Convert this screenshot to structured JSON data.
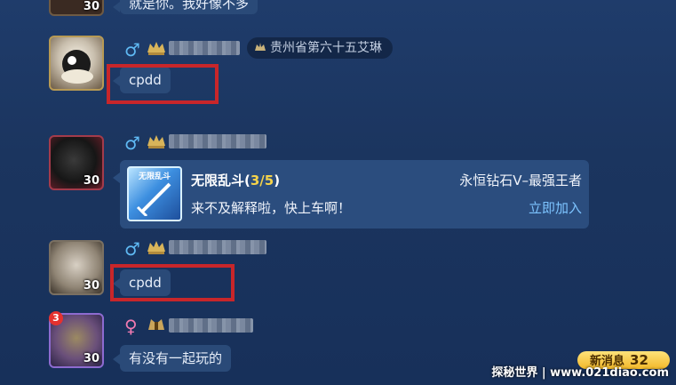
{
  "top_partial": {
    "level": "30",
    "text": "就是你。我好像不多"
  },
  "messages": [
    {
      "gender": "♂",
      "level": "",
      "title_tag": "贵州省第六十五艾琳",
      "text": "cpdd"
    },
    {
      "gender": "♂",
      "level": "30"
    },
    {
      "gender": "♂",
      "level": "30",
      "text": "cpdd"
    },
    {
      "gender": "♀",
      "level": "30",
      "unread": "3",
      "text": "有没有一起玩的"
    }
  ],
  "invite_card": {
    "thumb_label": "无限乱斗",
    "mode": "无限乱斗",
    "count_open": "(",
    "count": "3/5",
    "count_close": ")",
    "rank": "永恒钻石V–最强王者",
    "subtitle": "来不及解释啦，快上车啊！",
    "join_label": "立即加入"
  },
  "new_messages": {
    "label": "新消息",
    "count": "32"
  },
  "watermark": "探秘世界 | www.021diao.com",
  "colors": {
    "highlight_box": "#c8262a",
    "male": "#5fb9f3",
    "female": "#f07ab1",
    "join": "#7dc4ff",
    "count": "#f5d34a"
  }
}
